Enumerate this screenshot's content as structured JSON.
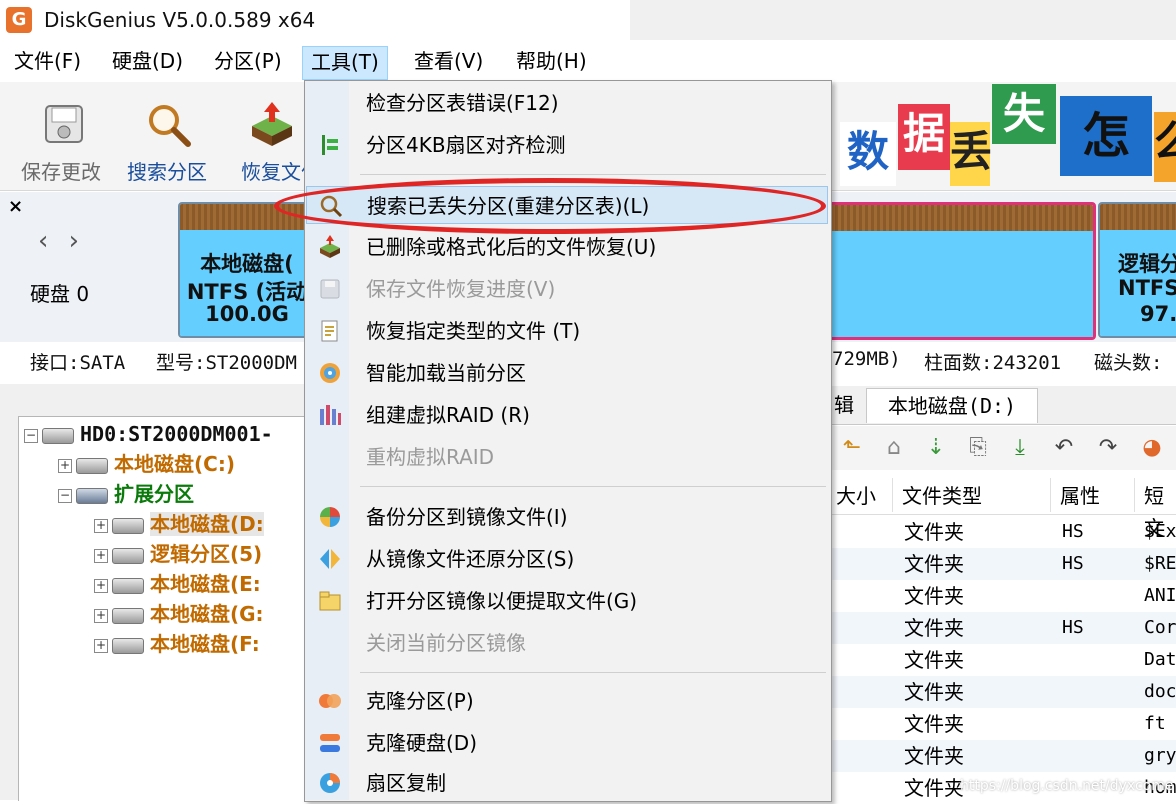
{
  "window": {
    "title": "DiskGenius V5.0.0.589 x64",
    "app_icon_letter": "G",
    "app_icon_color": "#e8712c"
  },
  "menu": {
    "items": [
      {
        "label": "文件(F)"
      },
      {
        "label": "硬盘(D)"
      },
      {
        "label": "分区(P)"
      },
      {
        "label": "工具(T)",
        "active": true
      },
      {
        "label": "查看(V)"
      },
      {
        "label": "帮助(H)"
      }
    ]
  },
  "toolbar": {
    "save_label": "保存更改",
    "search_label": "搜索分区",
    "recover_label": "恢复文件"
  },
  "banner": {
    "chars": [
      "数",
      "据",
      "丢",
      "失",
      "怎",
      "么"
    ]
  },
  "disk_map": {
    "close": "×",
    "arrows": "‹ ›",
    "disk_label": "硬盘 0",
    "partitions": [
      {
        "name": "本地磁盘(",
        "fs": "NTFS (活动",
        "size": "100.0G"
      },
      {
        "name": "逻辑分",
        "fs": "NTFS",
        "size": "97."
      }
    ]
  },
  "info": {
    "interface": "接口:SATA",
    "model": "型号:ST2000DM",
    "capacity": "729MB)",
    "cylinders": "柱面数:243201",
    "heads": "磁头数:"
  },
  "tree": {
    "root": "HD0:ST2000DM001-",
    "items": [
      {
        "label": "本地磁盘(C:)",
        "level": 1
      },
      {
        "label": "扩展分区",
        "level": 1
      },
      {
        "label": "本地磁盘(D:",
        "level": 2
      },
      {
        "label": "逻辑分区(5)",
        "level": 2
      },
      {
        "label": "本地磁盘(E:",
        "level": 2
      },
      {
        "label": "本地磁盘(G:",
        "level": 2
      },
      {
        "label": "本地磁盘(F:",
        "level": 2
      }
    ]
  },
  "file_panel": {
    "tab_partial": "辑",
    "tab_active": "本地磁盘(D:)",
    "columns": [
      "大小",
      "文件类型",
      "属性",
      "短文"
    ],
    "rows": [
      {
        "type": "文件夹",
        "attr": "HS",
        "short": "$Ex"
      },
      {
        "type": "文件夹",
        "attr": "HS",
        "short": "$RE"
      },
      {
        "type": "文件夹",
        "attr": "",
        "short": "ANI"
      },
      {
        "type": "文件夹",
        "attr": "HS",
        "short": "Cor"
      },
      {
        "type": "文件夹",
        "attr": "",
        "short": "Dat"
      },
      {
        "type": "文件夹",
        "attr": "",
        "short": "doc"
      },
      {
        "type": "文件夹",
        "attr": "",
        "short": "ft"
      },
      {
        "type": "文件夹",
        "attr": "",
        "short": "gry"
      },
      {
        "type": "文件夹",
        "attr": "",
        "short": "hom"
      }
    ]
  },
  "dropdown": {
    "items": [
      {
        "label": "检查分区表错误(F12)",
        "icon": "none"
      },
      {
        "label": "分区4KB扇区对齐检测",
        "icon": "align-icon"
      },
      {
        "label": "搜索已丢失分区(重建分区表)(L)",
        "icon": "search-icon",
        "highlighted": true
      },
      {
        "label": "已删除或格式化后的文件恢复(U)",
        "icon": "recover-icon"
      },
      {
        "label": "保存文件恢复进度(V)",
        "icon": "save-icon",
        "disabled": true
      },
      {
        "label": "恢复指定类型的文件 (T)",
        "icon": "filetype-icon"
      },
      {
        "label": "智能加载当前分区",
        "icon": "smart-load-icon"
      },
      {
        "label": "组建虚拟RAID (R)",
        "icon": "raid-icon"
      },
      {
        "label": "重构虚拟RAID",
        "icon": "none",
        "disabled": true
      },
      {
        "label": "备份分区到镜像文件(I)",
        "icon": "backup-icon"
      },
      {
        "label": "从镜像文件还原分区(S)",
        "icon": "restore-icon"
      },
      {
        "label": "打开分区镜像以便提取文件(G)",
        "icon": "open-image-icon"
      },
      {
        "label": "关闭当前分区镜像",
        "icon": "none",
        "disabled": true
      },
      {
        "label": "克隆分区(P)",
        "icon": "clone-partition-icon"
      },
      {
        "label": "克隆硬盘(D)",
        "icon": "clone-disk-icon"
      },
      {
        "label": "扇区复制",
        "icon": "sector-copy-icon"
      }
    ]
  },
  "watermark": "https://blog.csdn.net/dyxcome"
}
